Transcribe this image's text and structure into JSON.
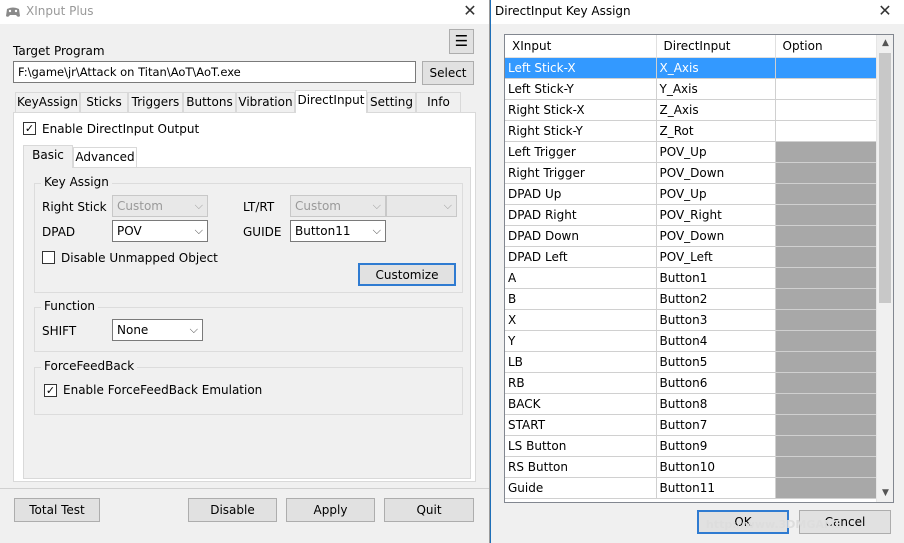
{
  "left_window": {
    "title": "XInput Plus",
    "target_program_label": "Target Program",
    "target_path": "F:\\game\\jr\\Attack on Titan\\AoT\\AoT.exe",
    "select_button": "Select",
    "tabs": [
      "KeyAssign",
      "Sticks",
      "Triggers",
      "Buttons",
      "Vibration",
      "DirectInput",
      "Setting",
      "Info"
    ],
    "active_tab": "DirectInput",
    "enable_directinput_label": "Enable DirectInput Output",
    "enable_directinput_checked": true,
    "subtabs": [
      "Basic",
      "Advanced"
    ],
    "active_subtab": "Basic",
    "key_assign": {
      "title": "Key Assign",
      "right_stick_label": "Right Stick",
      "right_stick_value": "Custom",
      "ltrt_label": "LT/RT",
      "ltrt_value": "Custom",
      "dpad_label": "DPAD",
      "dpad_value": "POV",
      "guide_label": "GUIDE",
      "guide_value": "Button11",
      "disable_unmapped_label": "Disable Unmapped Object",
      "disable_unmapped_checked": false,
      "customize_button": "Customize"
    },
    "function": {
      "title": "Function",
      "shift_label": "SHIFT",
      "shift_value": "None"
    },
    "forcefeedback": {
      "title": "ForceFeedBack",
      "enable_label": "Enable ForceFeedBack Emulation",
      "enable_checked": true
    },
    "bottom_buttons": {
      "total_test": "Total Test",
      "disable": "Disable",
      "apply": "Apply",
      "quit": "Quit"
    }
  },
  "right_window": {
    "title": "DirectInput Key Assign",
    "columns": [
      "XInput",
      "DirectInput",
      "Option"
    ],
    "rows": [
      {
        "xinput": "Left Stick-X",
        "dinput": "X_Axis",
        "option_gray": false,
        "selected": true
      },
      {
        "xinput": "Left Stick-Y",
        "dinput": "Y_Axis",
        "option_gray": false,
        "selected": false
      },
      {
        "xinput": "Right Stick-X",
        "dinput": "Z_Axis",
        "option_gray": false,
        "selected": false
      },
      {
        "xinput": "Right Stick-Y",
        "dinput": "Z_Rot",
        "option_gray": false,
        "selected": false
      },
      {
        "xinput": "Left Trigger",
        "dinput": "POV_Up",
        "option_gray": true,
        "selected": false
      },
      {
        "xinput": "Right Trigger",
        "dinput": "POV_Down",
        "option_gray": true,
        "selected": false
      },
      {
        "xinput": "DPAD Up",
        "dinput": "POV_Up",
        "option_gray": true,
        "selected": false
      },
      {
        "xinput": "DPAD Right",
        "dinput": "POV_Right",
        "option_gray": true,
        "selected": false
      },
      {
        "xinput": "DPAD Down",
        "dinput": "POV_Down",
        "option_gray": true,
        "selected": false
      },
      {
        "xinput": "DPAD Left",
        "dinput": "POV_Left",
        "option_gray": true,
        "selected": false
      },
      {
        "xinput": "A",
        "dinput": "Button1",
        "option_gray": true,
        "selected": false
      },
      {
        "xinput": "B",
        "dinput": "Button2",
        "option_gray": true,
        "selected": false
      },
      {
        "xinput": "X",
        "dinput": "Button3",
        "option_gray": true,
        "selected": false
      },
      {
        "xinput": "Y",
        "dinput": "Button4",
        "option_gray": true,
        "selected": false
      },
      {
        "xinput": "LB",
        "dinput": "Button5",
        "option_gray": true,
        "selected": false
      },
      {
        "xinput": "RB",
        "dinput": "Button6",
        "option_gray": true,
        "selected": false
      },
      {
        "xinput": "BACK",
        "dinput": "Button8",
        "option_gray": true,
        "selected": false
      },
      {
        "xinput": "START",
        "dinput": "Button7",
        "option_gray": true,
        "selected": false
      },
      {
        "xinput": "LS Button",
        "dinput": "Button9",
        "option_gray": true,
        "selected": false
      },
      {
        "xinput": "RS Button",
        "dinput": "Button10",
        "option_gray": true,
        "selected": false
      },
      {
        "xinput": "Guide",
        "dinput": "Button11",
        "option_gray": true,
        "selected": false
      }
    ],
    "ok_button": "OK",
    "cancel_button": "Cancel"
  },
  "watermark": "http://www.3DMGAME",
  "colors": {
    "selection": "#3399ff",
    "option_gray": "#a8a8a8",
    "focus_border": "#2f7bd1",
    "desktop": "#1e6fb8"
  }
}
